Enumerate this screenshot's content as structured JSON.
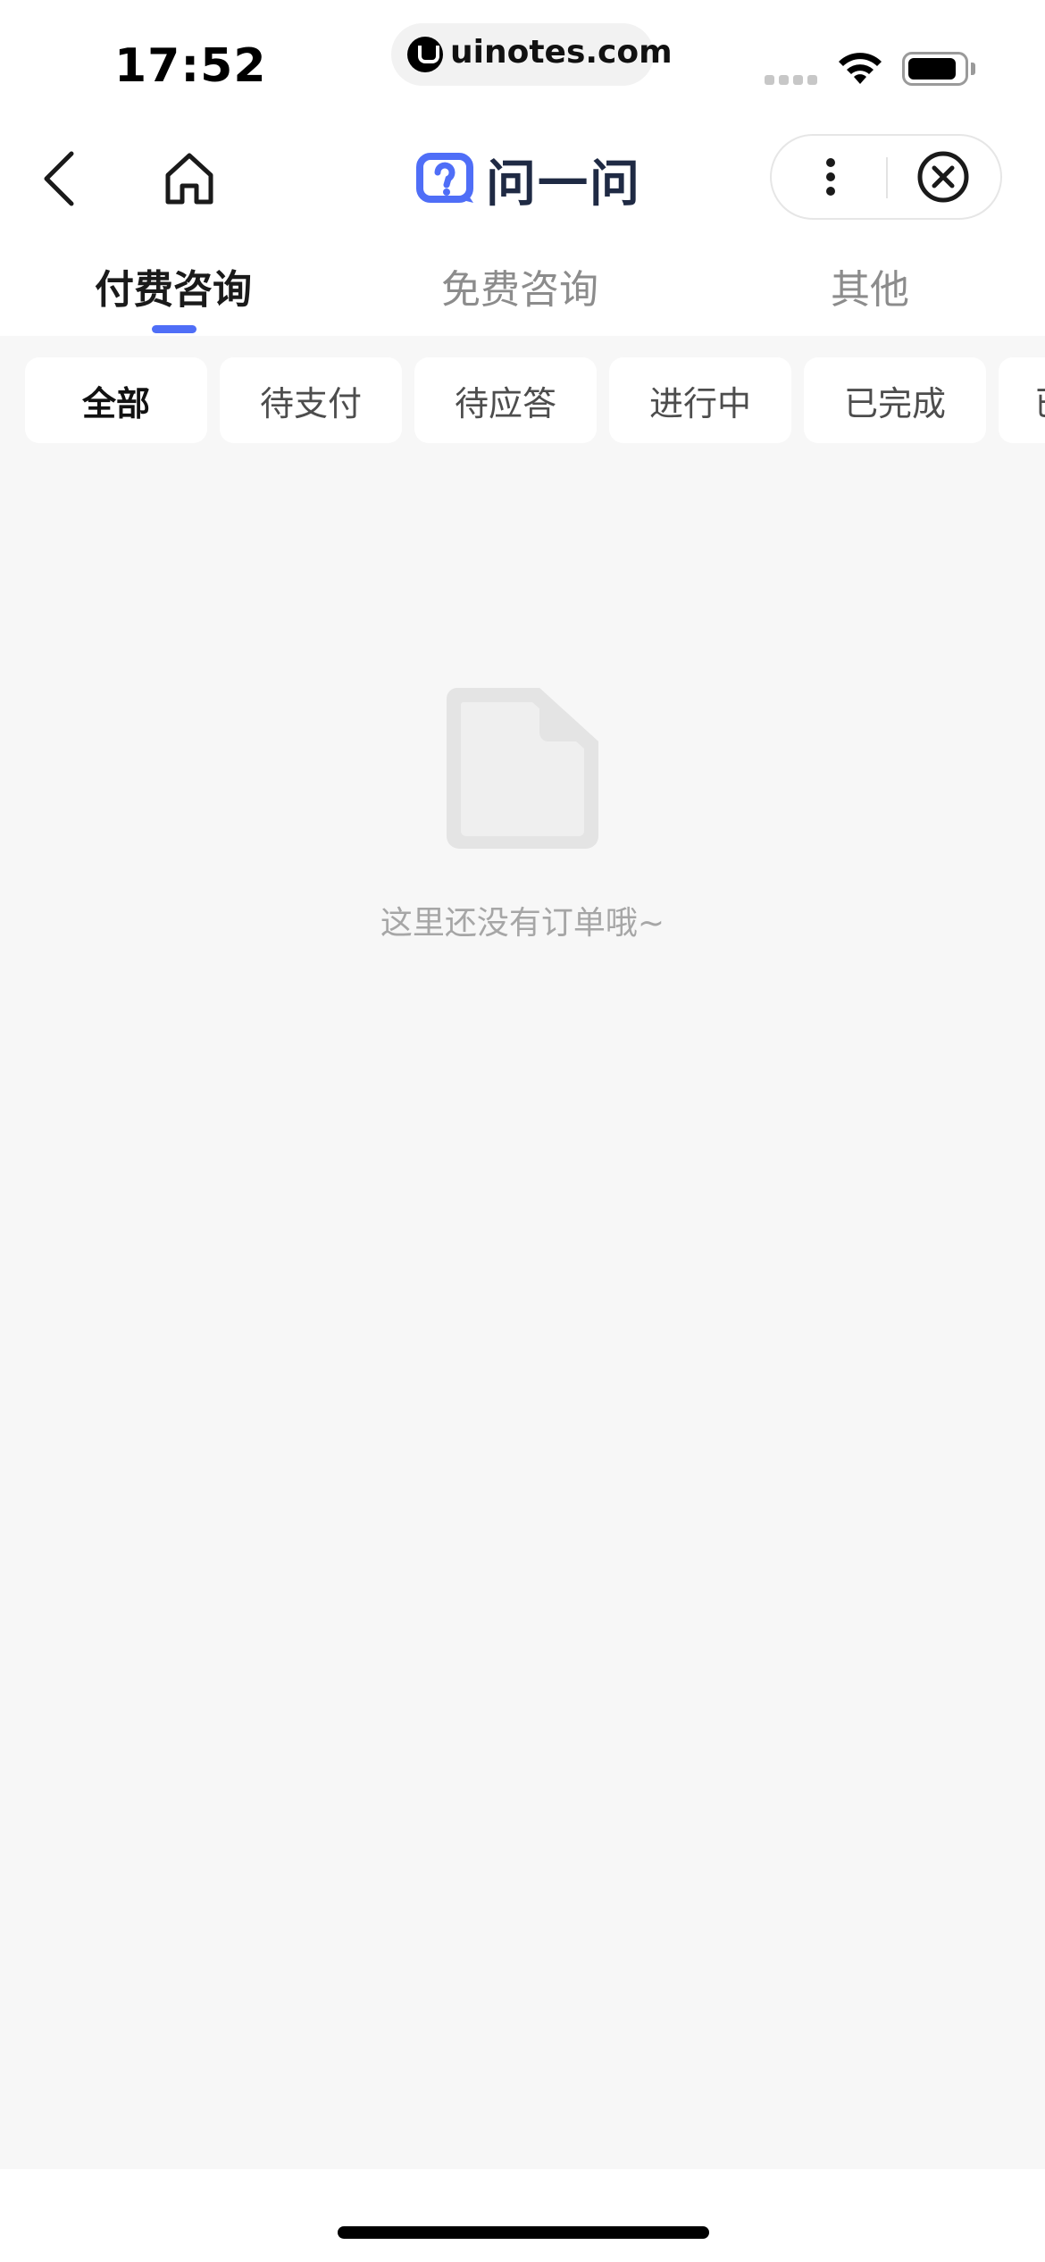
{
  "status_bar": {
    "time": "17:52",
    "url": "uinotes.com",
    "battery_level": 0.85
  },
  "nav": {
    "back_icon": "chevron-left-icon",
    "home_icon": "home-icon",
    "logo_text": "问一问",
    "more_icon": "more-vertical-icon",
    "close_icon": "close-circle-icon"
  },
  "tabs": [
    {
      "label": "付费咨询",
      "active": true
    },
    {
      "label": "免费咨询",
      "active": false
    },
    {
      "label": "其他",
      "active": false
    }
  ],
  "filters": [
    {
      "label": "全部",
      "active": true
    },
    {
      "label": "待支付",
      "active": false
    },
    {
      "label": "待应答",
      "active": false
    },
    {
      "label": "进行中",
      "active": false
    },
    {
      "label": "已完成",
      "active": false
    },
    {
      "label": "已",
      "active": false
    }
  ],
  "empty_state": {
    "icon": "document-icon",
    "message": "这里还没有订单哦~"
  },
  "colors": {
    "accent": "#4f6ef7",
    "background": "#f7f7f7"
  }
}
